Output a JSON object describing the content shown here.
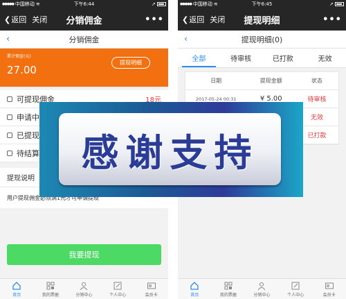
{
  "left": {
    "status": {
      "carrier": "中国移动",
      "time": "下午6:44"
    },
    "nav": {
      "back": "返回",
      "close": "关闭",
      "title": "分销佣金",
      "more": "•••"
    },
    "page_title": "分销佣金",
    "commission": {
      "label": "累计佣金(元)",
      "amount": "27.00",
      "detail_button": "提现明细"
    },
    "menu": [
      {
        "label": "可提现佣金",
        "value": "18元"
      },
      {
        "label": "申请中",
        "value": ""
      },
      {
        "label": "已提现",
        "value": ""
      },
      {
        "label": "待结算",
        "value": ""
      }
    ],
    "section_title": "提现说明",
    "section_desc": "用户提现佣金必须满1元才可申请提现",
    "apply_button": "我要提现"
  },
  "right": {
    "status": {
      "carrier": "中国移动",
      "time": "下午6:45"
    },
    "nav": {
      "back": "返回",
      "close": "关闭",
      "title": "提现明细",
      "more": "•••"
    },
    "page_title": "提现明细(0)",
    "tabs": [
      "全部",
      "待审核",
      "已打款",
      "无效"
    ],
    "table_headers": [
      "日期",
      "提现金额",
      "状态"
    ],
    "rows": [
      {
        "date": "2017-05-24 00:31",
        "amount": "¥ 5.00",
        "status": "待审核"
      },
      {
        "date": "",
        "amount": "",
        "status": "无效"
      },
      {
        "date": "",
        "amount": "",
        "status": "已打款"
      }
    ]
  },
  "tabbar": [
    {
      "label": "首页",
      "icon": "home-icon",
      "active": true
    },
    {
      "label": "我的票据",
      "icon": "qrcode-icon",
      "active": false
    },
    {
      "label": "分销中心",
      "icon": "users-icon",
      "active": false
    },
    {
      "label": "个人中心",
      "icon": "edit-icon",
      "active": false
    },
    {
      "label": "会员卡",
      "icon": "card-icon",
      "active": false
    }
  ],
  "banner": {
    "text": "感谢支持"
  },
  "colors": {
    "orange": "#f2700f",
    "green": "#4cd964",
    "blue": "#2d8cf0",
    "red": "#e4393c",
    "navbar": "#262626"
  }
}
